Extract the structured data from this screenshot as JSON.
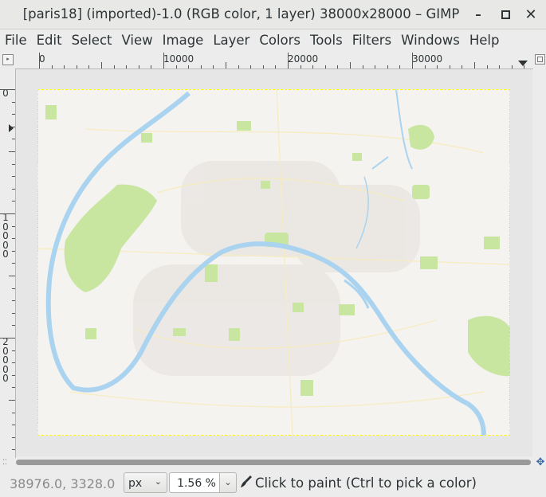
{
  "window": {
    "title": "[paris18] (imported)-1.0 (RGB color, 1 layer) 38000x28000 – GIMP",
    "minimize_icon": "minimize-icon",
    "maximize_icon": "maximize-icon",
    "close_icon": "close-icon"
  },
  "menu": {
    "items": [
      "File",
      "Edit",
      "Select",
      "View",
      "Image",
      "Layer",
      "Colors",
      "Tools",
      "Filters",
      "Windows",
      "Help"
    ]
  },
  "rulers": {
    "horizontal_labels": [
      "0",
      "10000",
      "20000",
      "30000"
    ],
    "vertical_labels": [
      "0",
      "1\n0\n0\n0\n0",
      "2\n0\n0\n0\n0"
    ]
  },
  "canvas": {
    "image_name": "paris18",
    "image_description_icon": "map-image",
    "colors": {
      "background": "#f3f2ef",
      "water": "#aad3f0",
      "park": "#c8e6a0",
      "selection": "#ffff00"
    }
  },
  "status": {
    "pointer_coords": "38976.0, 3328.0",
    "unit": "px",
    "zoom": "1.56 %",
    "message": "Click to paint (Ctrl to pick a color)",
    "tool_icon": "paintbrush-icon"
  }
}
